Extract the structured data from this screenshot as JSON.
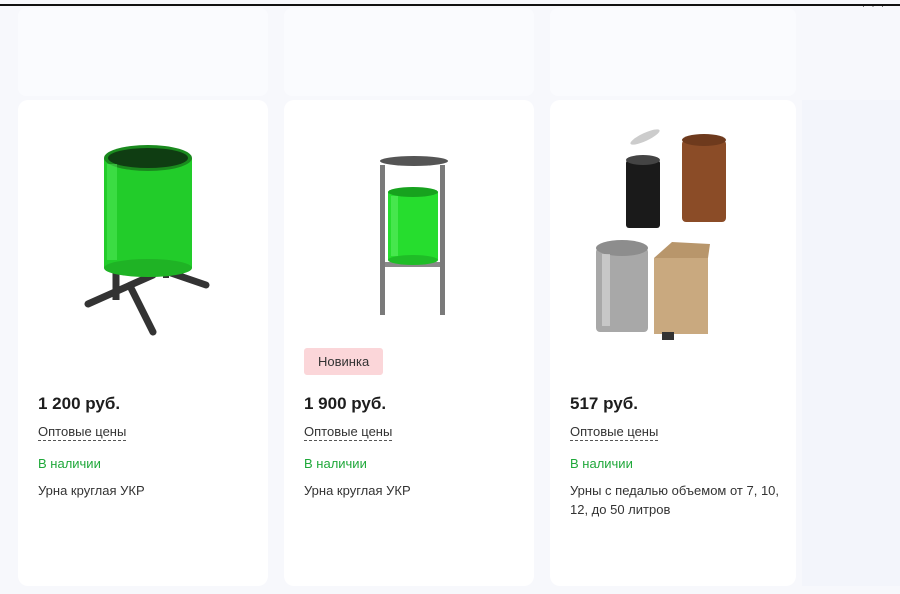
{
  "products": [
    {
      "badge": "",
      "price": "1 200 руб.",
      "wholesale": "Оптовые цены",
      "stock": "В наличии",
      "name": "Урна круглая УКР"
    },
    {
      "badge": "Новинка",
      "price": "1 900 руб.",
      "wholesale": "Оптовые цены",
      "stock": "В наличии",
      "name": "Урна круглая УКР"
    },
    {
      "badge": "",
      "price": "517 руб.",
      "wholesale": "Оптовые цены",
      "stock": "В наличии",
      "name": "Урны с педалью объемом от 7, 10, 12, до 50 литров"
    }
  ],
  "colors": {
    "stock": "#1fa83a",
    "badge_bg": "#fbd6d9",
    "bin_green": "#22cc2a"
  }
}
